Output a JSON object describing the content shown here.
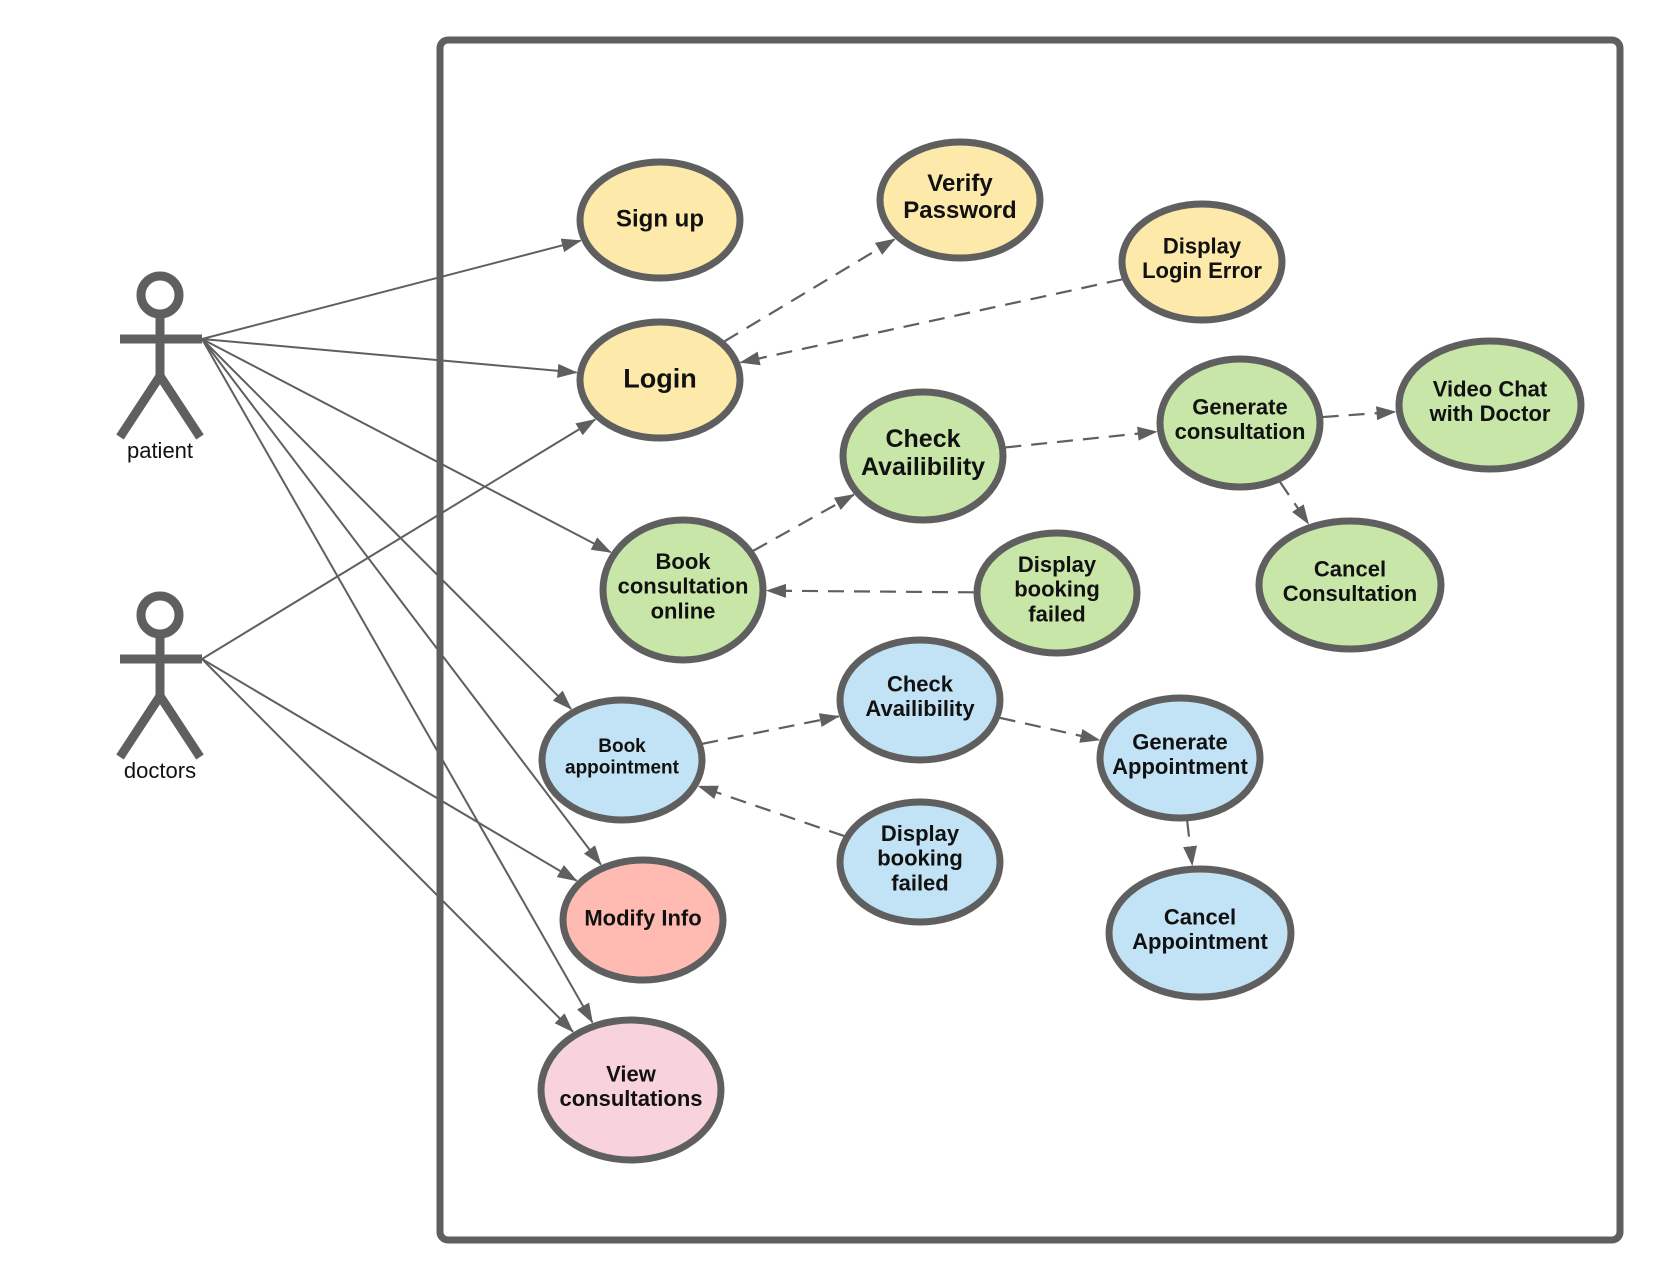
{
  "diagram": {
    "type": "UML use case diagram",
    "colors": {
      "stroke": "#5f5f5f",
      "yellow": "#fde9a9",
      "green": "#c8e6a8",
      "blue": "#c2e3f5",
      "salmon": "#ffbbb1",
      "pink": "#f8d3dc"
    },
    "actors": [
      {
        "id": "patient",
        "label": "patient"
      },
      {
        "id": "doctors",
        "label": "doctors"
      }
    ],
    "use_cases": [
      {
        "id": "signup",
        "lines": [
          "Sign up"
        ],
        "color": "yellow"
      },
      {
        "id": "login",
        "lines": [
          "Login"
        ],
        "color": "yellow"
      },
      {
        "id": "verify",
        "lines": [
          "Verify",
          "Password"
        ],
        "color": "yellow"
      },
      {
        "id": "loginerr",
        "lines": [
          "Display",
          "Login Error"
        ],
        "color": "yellow"
      },
      {
        "id": "checkc",
        "lines": [
          "Check",
          "Availibility"
        ],
        "color": "green"
      },
      {
        "id": "genc",
        "lines": [
          "Generate",
          "consultation"
        ],
        "color": "green"
      },
      {
        "id": "video",
        "lines": [
          "Video Chat",
          "with Doctor"
        ],
        "color": "green"
      },
      {
        "id": "bookc",
        "lines": [
          "Book",
          "consultation",
          "online"
        ],
        "color": "green"
      },
      {
        "id": "failc",
        "lines": [
          "Display",
          "booking",
          "failed"
        ],
        "color": "green"
      },
      {
        "id": "cancelc",
        "lines": [
          "Cancel",
          "Consultation"
        ],
        "color": "green"
      },
      {
        "id": "booka",
        "lines": [
          "Book",
          "appointment"
        ],
        "color": "blue"
      },
      {
        "id": "checka",
        "lines": [
          "Check",
          "Availibility"
        ],
        "color": "blue"
      },
      {
        "id": "gena",
        "lines": [
          "Generate",
          "Appointment"
        ],
        "color": "blue"
      },
      {
        "id": "faila",
        "lines": [
          "Display",
          "booking",
          "failed"
        ],
        "color": "blue"
      },
      {
        "id": "cancela",
        "lines": [
          "Cancel",
          "Appointment"
        ],
        "color": "blue"
      },
      {
        "id": "modify",
        "lines": [
          "Modify Info"
        ],
        "color": "salmon"
      },
      {
        "id": "view",
        "lines": [
          "View",
          "consultations"
        ],
        "color": "pink"
      }
    ],
    "associations": [
      {
        "from": "patient",
        "to": "signup"
      },
      {
        "from": "patient",
        "to": "login"
      },
      {
        "from": "patient",
        "to": "bookc"
      },
      {
        "from": "patient",
        "to": "booka"
      },
      {
        "from": "patient",
        "to": "modify"
      },
      {
        "from": "patient",
        "to": "view"
      },
      {
        "from": "doctors",
        "to": "login"
      },
      {
        "from": "doctors",
        "to": "modify"
      },
      {
        "from": "doctors",
        "to": "view"
      }
    ],
    "dependencies": [
      {
        "from": "login",
        "to": "verify"
      },
      {
        "from": "loginerr",
        "to": "login"
      },
      {
        "from": "bookc",
        "to": "checkc"
      },
      {
        "from": "checkc",
        "to": "genc"
      },
      {
        "from": "genc",
        "to": "video"
      },
      {
        "from": "genc",
        "to": "cancelc"
      },
      {
        "from": "failc",
        "to": "bookc"
      },
      {
        "from": "booka",
        "to": "checka"
      },
      {
        "from": "checka",
        "to": "gena"
      },
      {
        "from": "gena",
        "to": "cancela"
      },
      {
        "from": "faila",
        "to": "booka"
      }
    ]
  }
}
